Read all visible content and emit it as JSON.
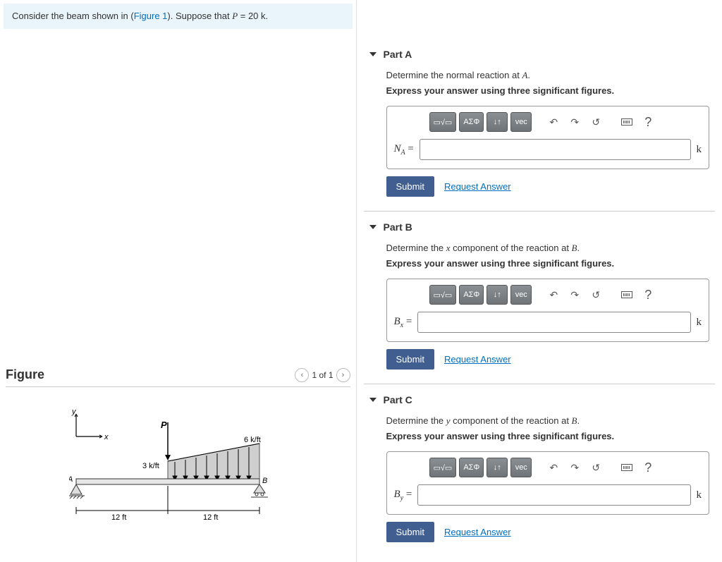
{
  "problem_statement": {
    "prefix": "Consider the beam shown in (",
    "figure_link": "Figure 1",
    "suffix": "). Suppose that ",
    "var": "P",
    "eq": " = 20 k."
  },
  "figure": {
    "heading": "Figure",
    "pager_text": "1 of 1",
    "labels": {
      "y": "y",
      "x": "x",
      "P": "P",
      "load_left": "3 k/ft",
      "load_right": "6 k/ft",
      "A": "A",
      "B": "B",
      "span_left": "12 ft",
      "span_right": "12 ft"
    }
  },
  "toolbar": {
    "templates": "▭√▭",
    "greek": "ΑΣΦ",
    "arrows": "↓↑",
    "vec": "vec",
    "undo": "↶",
    "redo": "↷",
    "reset": "↺",
    "help": "?"
  },
  "parts": [
    {
      "title": "Part A",
      "prompt_pre": "Determine the normal reaction at ",
      "prompt_var": "A",
      "prompt_post": ".",
      "instruction": "Express your answer using three significant figures.",
      "label_base": "N",
      "label_sub": "A",
      "label_eq": " = ",
      "unit": "k",
      "submit": "Submit",
      "request": "Request Answer"
    },
    {
      "title": "Part B",
      "prompt_pre": "Determine the ",
      "prompt_var": "x",
      "prompt_mid": " component of the reaction at ",
      "prompt_var2": "B",
      "prompt_post": ".",
      "instruction": "Express your answer using three significant figures.",
      "label_base": "B",
      "label_sub": "x",
      "label_eq": " = ",
      "unit": "k",
      "submit": "Submit",
      "request": "Request Answer"
    },
    {
      "title": "Part C",
      "prompt_pre": "Determine the ",
      "prompt_var": "y",
      "prompt_mid": " component of the reaction at ",
      "prompt_var2": "B",
      "prompt_post": ".",
      "instruction": "Express your answer using three significant figures.",
      "label_base": "B",
      "label_sub": "y",
      "label_eq": " = ",
      "unit": "k",
      "submit": "Submit",
      "request": "Request Answer"
    }
  ]
}
